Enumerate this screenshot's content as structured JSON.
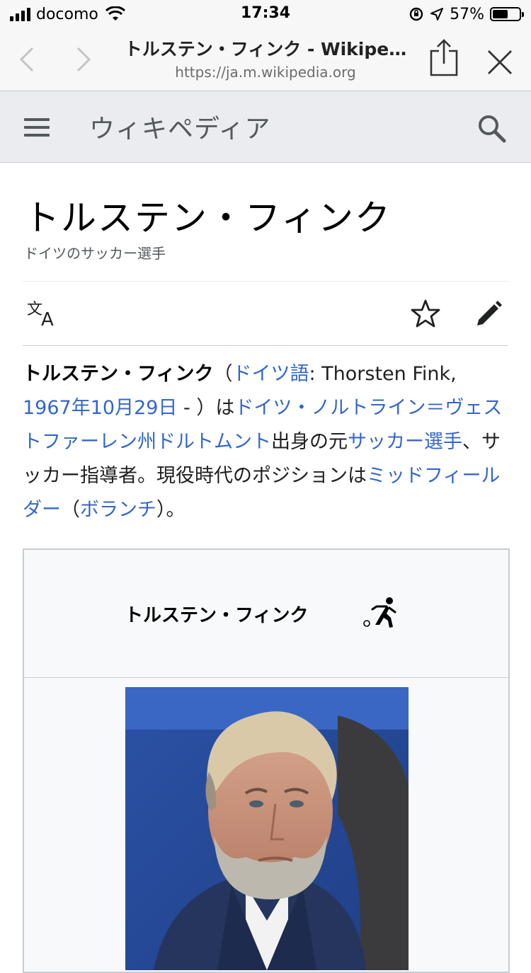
{
  "status_bar": {
    "carrier": "docomo",
    "time": "17:34",
    "battery_percent": "57%",
    "battery_level": 0.57
  },
  "browser": {
    "page_title": "トルステン・フィンク - Wikipe…",
    "url": "https://ja.m.wikipedia.org"
  },
  "wiki_header": {
    "logo_text": "ウィキペディア"
  },
  "article": {
    "title": "トルステン・フィンク",
    "description": "ドイツのサッカー選手",
    "lead": {
      "name": "トルステン・フィンク",
      "paren_open": "（",
      "link_german": "ドイツ語",
      "german_name": ": Thorsten Fink, ",
      "link_birthdate": "1967年10月29日",
      "dash": " - ）は",
      "link_place": "ドイツ・ノルトライン＝ヴェストファーレン州ドルトムント",
      "text_origin": "出身の元",
      "link_soccer_player": "サッカー選手",
      "text_coach": "、サッカー指導者。現役時代のポジションは",
      "link_midfielder": "ミッドフィールダー",
      "paren2_open": "（",
      "link_volante": "ボランチ",
      "text_end": "）。"
    }
  },
  "infobox": {
    "title": "トルステン・フィンク"
  },
  "colors": {
    "link": "#3366cc",
    "header_bg": "#eaecf0",
    "border": "#c8ccd1"
  },
  "icons": [
    "back-icon",
    "forward-icon",
    "share-icon",
    "close-icon",
    "menu-icon",
    "search-icon",
    "language-icon",
    "star-icon",
    "edit-icon",
    "soccer-player-icon"
  ]
}
